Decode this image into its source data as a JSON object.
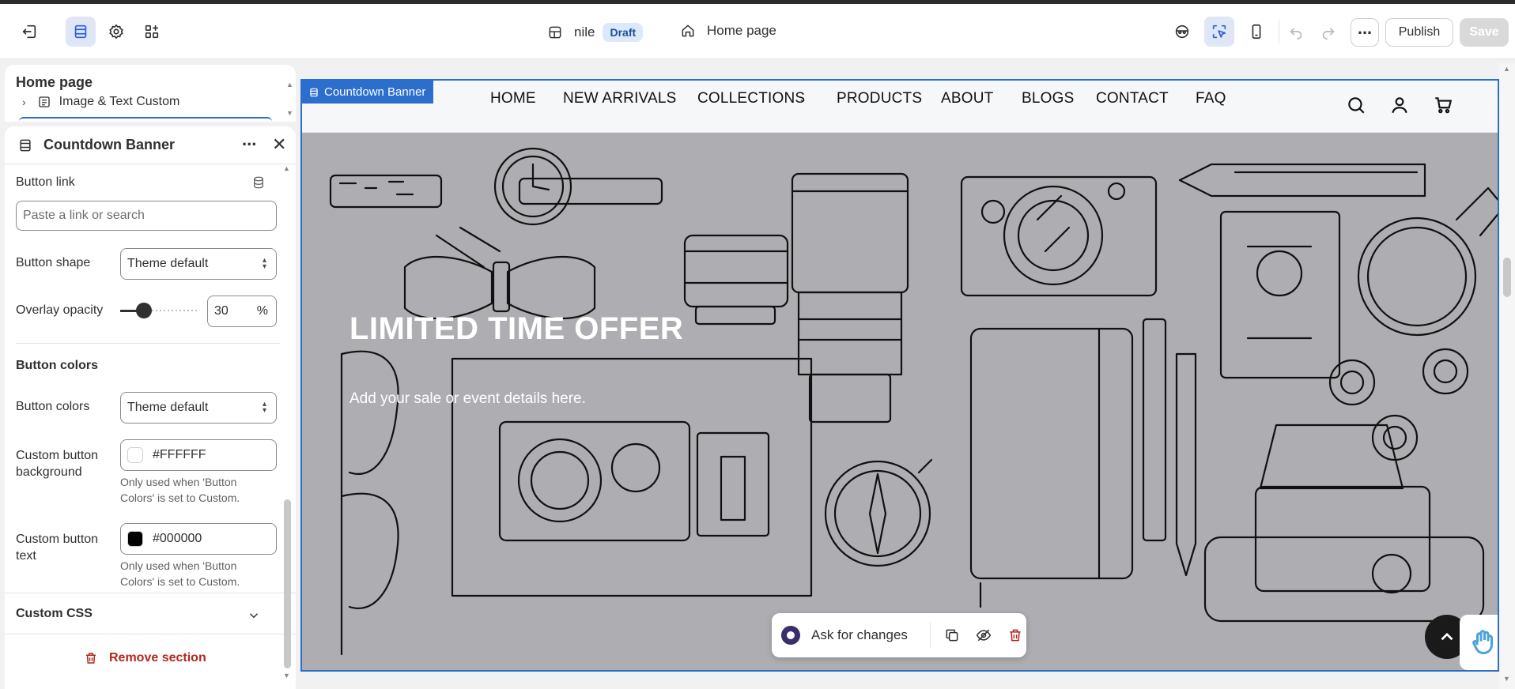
{
  "topbar": {
    "store_name": "nile",
    "status_badge": "Draft",
    "page_selector": "Home page",
    "publish_label": "Publish",
    "save_label": "Save"
  },
  "left_panel": {
    "tree_title": "Home page",
    "tree_item": "Image & Text Custom",
    "section_title": "Countdown Banner",
    "button_link_label": "Button link",
    "button_link_placeholder": "Paste a link or search",
    "button_shape_label": "Button shape",
    "button_shape_value": "Theme default",
    "overlay_opacity_label": "Overlay opacity",
    "overlay_opacity_value": "30",
    "overlay_opacity_unit": "%",
    "overlay_opacity_level": 0.3,
    "button_colors_heading": "Button colors",
    "button_colors_label": "Button colors",
    "button_colors_value": "Theme default",
    "custom_bg_label_1": "Custom button",
    "custom_bg_label_2": "background",
    "custom_bg_value": "#FFFFFF",
    "custom_bg_color": "#FFFFFF",
    "custom_bg_hint_1": "Only used when 'Button",
    "custom_bg_hint_2": "Colors' is set to Custom.",
    "custom_text_label_1": "Custom button",
    "custom_text_label_2": "text",
    "custom_text_value": "#000000",
    "custom_text_color": "#000000",
    "custom_text_hint_1": "Only used when 'Button",
    "custom_text_hint_2": "Colors' is set to Custom.",
    "custom_css_label": "Custom CSS",
    "remove_section_label": "Remove section"
  },
  "preview": {
    "section_tag": "Countdown Banner",
    "nav": [
      "HOME",
      "NEW ARRIVALS",
      "COLLECTIONS",
      "PRODUCTS",
      "ABOUT",
      "BLOGS",
      "CONTACT",
      "FAQ"
    ],
    "headline": "LIMITED TIME OFFER",
    "subtext": "Add your sale or event details here.",
    "ask_label": "Ask for changes"
  },
  "colors": {
    "accent": "#2c6ecb",
    "remove": "#b3261e",
    "badge_bg": "#dce9fb"
  }
}
